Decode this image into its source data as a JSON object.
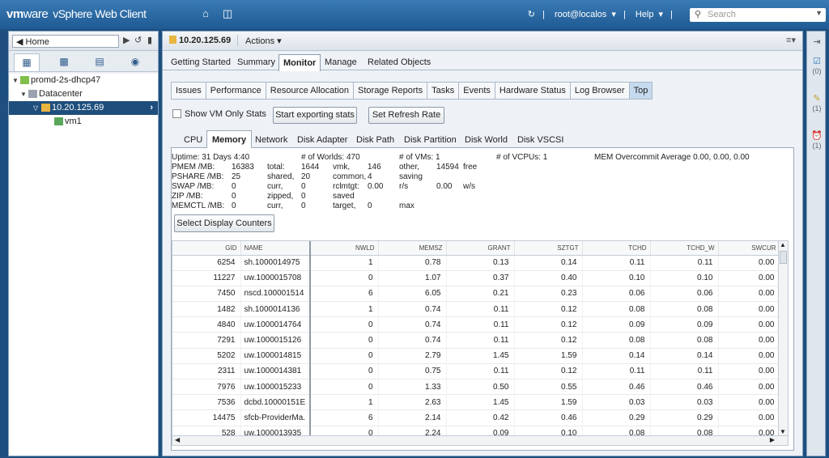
{
  "topbar": {
    "brand_vm": "vm",
    "brand_ware": "ware",
    "brand_product": "vSphere Web Client",
    "refresh_sep": "|",
    "user": "root@localos",
    "help": "Help",
    "sep": "|",
    "search_placeholder": "Search"
  },
  "left": {
    "home_label": "Home",
    "tree": [
      {
        "label": "promd-2s-dhcp47",
        "level": 0,
        "expanded": true
      },
      {
        "label": "Datacenter",
        "level": 1,
        "expanded": true
      },
      {
        "label": "10.20.125.69",
        "level": 2,
        "expanded": true,
        "selected": true
      },
      {
        "label": "vm1",
        "level": 3
      }
    ]
  },
  "main": {
    "host": "10.20.125.69",
    "actions": "Actions",
    "tabs": [
      "Getting Started",
      "Summary",
      "Monitor",
      "Manage",
      "Related Objects"
    ],
    "active_tab": "Monitor",
    "subtabs": [
      "Issues",
      "Performance",
      "Resource Allocation",
      "Storage Reports",
      "Tasks",
      "Events",
      "Hardware Status",
      "Log Browser",
      "Top"
    ],
    "active_subtab": "Top",
    "show_vm_only": "Show VM Only Stats",
    "export_btn": "Start exporting stats",
    "refresh_btn": "Set Refresh Rate",
    "top_tabs": [
      "CPU",
      "Memory",
      "Network",
      "Disk Adapter",
      "Disk Path",
      "Disk Partition",
      "Disk World",
      "Disk VSCSI"
    ],
    "active_top_tab": "Memory",
    "select_counters": "Select Display Counters"
  },
  "stats": {
    "uptime": "Uptime: 31 Days 4:40",
    "worlds": "# of Worlds: 470",
    "vms": "# of VMs: 1",
    "vcpus": "# of VCPUs: 1",
    "overcommit": "MEM Overcommit Average 0.00, 0.00, 0.00",
    "rows": [
      [
        "PMEM /MB:",
        "16383",
        "total:",
        "1644",
        "vmk,",
        "146",
        "other,",
        "14594",
        "free"
      ],
      [
        "PSHARE /MB:",
        "25",
        "shared,",
        "20",
        "common,",
        "4",
        "saving",
        "",
        ""
      ],
      [
        "SWAP /MB:",
        "0",
        "curr,",
        "0",
        "rclmtgt:",
        "0.00",
        "r/s",
        "0.00",
        "w/s"
      ],
      [
        "ZIP /MB:",
        "0",
        "zipped,",
        "0",
        "saved",
        "",
        "",
        "",
        ""
      ],
      [
        "MEMCTL /MB:",
        "0",
        "curr,",
        "0",
        "target,",
        "0",
        "max",
        "",
        ""
      ]
    ]
  },
  "grid": {
    "columns": [
      "GID",
      "NAME",
      "NWLD",
      "MEMSZ",
      "GRANT",
      "SZTGT",
      "TCHD",
      "TCHD_W",
      "SWCUR"
    ],
    "rows": [
      [
        "6254",
        "sh.1000014975",
        "1",
        "0.78",
        "0.13",
        "0.14",
        "0.11",
        "0.11",
        "0.00"
      ],
      [
        "11227",
        "uw.1000015708",
        "0",
        "1.07",
        "0.37",
        "0.40",
        "0.10",
        "0.10",
        "0.00"
      ],
      [
        "7450",
        "nscd.100001514",
        "6",
        "6.05",
        "0.21",
        "0.23",
        "0.06",
        "0.06",
        "0.00"
      ],
      [
        "1482",
        "sh.1000014136",
        "1",
        "0.74",
        "0.11",
        "0.12",
        "0.08",
        "0.08",
        "0.00"
      ],
      [
        "4840",
        "uw.1000014764",
        "0",
        "0.74",
        "0.11",
        "0.12",
        "0.09",
        "0.09",
        "0.00"
      ],
      [
        "7291",
        "uw.1000015126",
        "0",
        "0.74",
        "0.11",
        "0.12",
        "0.08",
        "0.08",
        "0.00"
      ],
      [
        "5202",
        "uw.1000014815",
        "0",
        "2.79",
        "1.45",
        "1.59",
        "0.14",
        "0.14",
        "0.00"
      ],
      [
        "2311",
        "uw.1000014381",
        "0",
        "0.75",
        "0.11",
        "0.12",
        "0.11",
        "0.11",
        "0.00"
      ],
      [
        "7976",
        "uw.1000015233",
        "0",
        "1.33",
        "0.50",
        "0.55",
        "0.46",
        "0.46",
        "0.00"
      ],
      [
        "7536",
        "dcbd.10000151E",
        "1",
        "2.63",
        "1.45",
        "1.59",
        "0.03",
        "0.03",
        "0.00"
      ],
      [
        "14475",
        "sfcb-ProviderMa.",
        "6",
        "2.14",
        "0.42",
        "0.46",
        "0.29",
        "0.29",
        "0.00"
      ],
      [
        "528",
        "uw.1000013935",
        "0",
        "2.24",
        "0.09",
        "0.10",
        "0.08",
        "0.08",
        "0.00"
      ]
    ]
  },
  "right_counts": [
    "(0)",
    "(1)",
    "(1)"
  ]
}
